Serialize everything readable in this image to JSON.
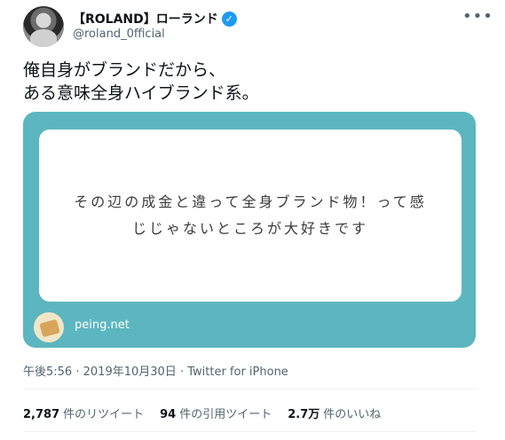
{
  "author": {
    "display_name": "【ROLAND】ローランド",
    "verified_glyph": "✓",
    "handle": "@roland_0fficial"
  },
  "more_glyph": "•••",
  "tweet_text": "俺自身がブランドだから、\nある意味全身ハイブランド系。",
  "card": {
    "question": "その辺の成金と違って全身ブランド物！って感\nじじゃないところが大好きです",
    "domain": "peing.net",
    "background_color": "#5cb6bf"
  },
  "meta": {
    "time": "午後5:56",
    "separator1": "·",
    "date": "2019年10月30日",
    "separator2": "·",
    "source": "Twitter for iPhone"
  },
  "stats": {
    "retweets_count": "2,787",
    "retweets_label": "件のリツイート",
    "quotes_count": "94",
    "quotes_label": "件の引用ツイート",
    "likes_count": "2.7万",
    "likes_label": "件のいいね"
  }
}
